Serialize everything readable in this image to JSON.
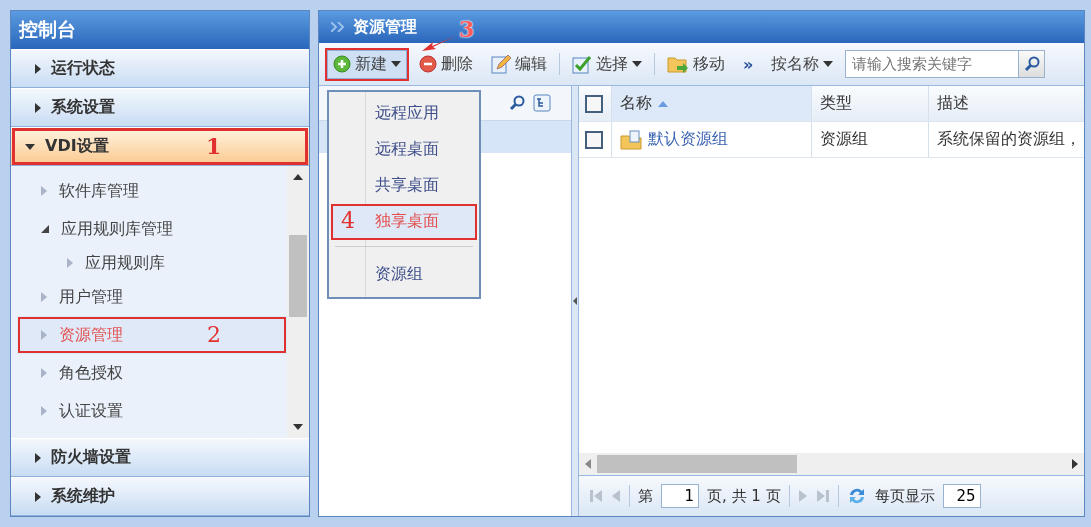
{
  "sidebar": {
    "title": "控制台",
    "sections": [
      {
        "label": "运行状态",
        "expanded": false
      },
      {
        "label": "系统设置",
        "expanded": false
      },
      {
        "label": "VDI设置",
        "expanded": true,
        "annotation": "1",
        "items": [
          {
            "label": "软件库管理",
            "selected": false
          },
          {
            "label": "应用规则库管理",
            "selected": false,
            "expanded": true,
            "children": [
              {
                "label": "应用规则库",
                "selected": false
              }
            ]
          },
          {
            "label": "用户管理",
            "selected": false
          },
          {
            "label": "资源管理",
            "selected": true,
            "annotation": "2"
          },
          {
            "label": "角色授权",
            "selected": false
          },
          {
            "label": "认证设置",
            "selected": false
          }
        ]
      },
      {
        "label": "防火墙设置",
        "expanded": false
      },
      {
        "label": "系统维护",
        "expanded": false
      }
    ]
  },
  "main": {
    "title": "资源管理",
    "toolbar": [
      {
        "kind": "new",
        "label": "新建",
        "annotation": "3",
        "menu": [
          {
            "label": "远程应用",
            "selected": false
          },
          {
            "label": "远程桌面",
            "selected": false
          },
          {
            "label": "共享桌面",
            "selected": false
          },
          {
            "label": "独享桌面",
            "selected": true,
            "annotation": "4"
          },
          {
            "kind": "separator"
          },
          {
            "label": "资源组",
            "selected": false
          }
        ]
      },
      {
        "kind": "delete",
        "label": "删除"
      },
      {
        "kind": "edit",
        "label": "编辑"
      },
      {
        "kind": "separator"
      },
      {
        "kind": "select",
        "label": "选择"
      },
      {
        "kind": "separator"
      },
      {
        "kind": "move",
        "label": "移动"
      },
      {
        "kind": "more",
        "label": "»"
      },
      {
        "kind": "filter",
        "label": "按名称"
      },
      {
        "kind": "search",
        "placeholder": "请输入搜索关键字"
      }
    ],
    "grid": {
      "all_checked": false,
      "columns": [
        {
          "label": "名称",
          "sorted": true
        },
        {
          "label": "类型",
          "sorted": false
        },
        {
          "label": "描述",
          "sorted": false
        }
      ],
      "rows": [
        {
          "checked": false,
          "name": "默认资源组",
          "type": "资源组",
          "description": "系统保留的资源组，"
        }
      ]
    },
    "pager": {
      "prefix": "第",
      "page": "1",
      "middle": "页, 共 1 页",
      "per_page_label": "每页显示",
      "per_page": "25"
    }
  }
}
